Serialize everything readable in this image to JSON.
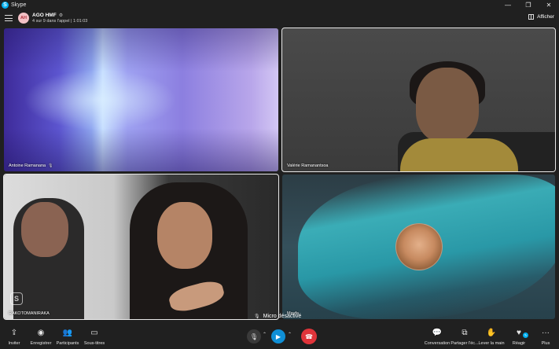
{
  "window": {
    "app_title": "Skype",
    "controls": [
      "—",
      "❐",
      "✕"
    ]
  },
  "call": {
    "avatar_initials": "AH",
    "name": "AGO HMF",
    "subtitle": "4 sur 9 dans l'appel | 1:01:03",
    "view_label": "Afficher"
  },
  "participants": [
    {
      "name": "Antoine Ramanana",
      "muted": true
    },
    {
      "name": "Valérie Ramanantsoa",
      "muted": false
    },
    {
      "name": "RAKOTOMANIRAKA",
      "muted": false
    },
    {
      "name": "Mayfa",
      "muted": false
    }
  ],
  "toast": {
    "text": "Micro désactivé"
  },
  "toolbar": {
    "left": [
      {
        "label": "Inviter",
        "icon": "share-icon"
      },
      {
        "label": "Enregistrer",
        "icon": "record-icon"
      },
      {
        "label": "Participants",
        "icon": "participants-icon"
      },
      {
        "label": "Sous-titres",
        "icon": "subtitles-icon"
      }
    ],
    "right": [
      {
        "label": "Conversation",
        "icon": "chat-icon"
      },
      {
        "label": "Partager l'éc...",
        "icon": "screen-share-icon"
      },
      {
        "label": "Lever la main",
        "icon": "raise-hand-icon"
      },
      {
        "label": "Réagir",
        "icon": "react-icon"
      },
      {
        "label": "Plus",
        "icon": "more-icon"
      }
    ]
  },
  "colors": {
    "end_call": "#e0343a",
    "camera_active": "#0f8fd6",
    "skype_blue": "#00aff0"
  }
}
